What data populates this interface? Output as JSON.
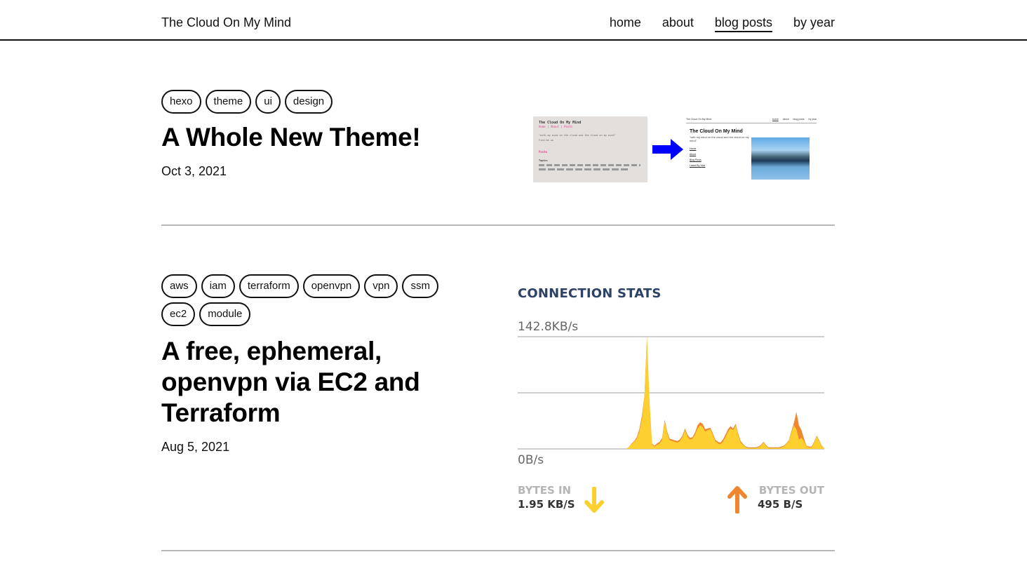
{
  "site": {
    "title": "The Cloud On My Mind"
  },
  "nav": [
    {
      "label": "home",
      "active": false
    },
    {
      "label": "about",
      "active": false
    },
    {
      "label": "blog posts",
      "active": true
    },
    {
      "label": "by year",
      "active": false
    }
  ],
  "posts": [
    {
      "tags": [
        "hexo",
        "theme",
        "ui",
        "design"
      ],
      "title": "A Whole New Theme!",
      "date": "Oct 3, 2021",
      "thumbnail": {
        "old_theme": {
          "title": "The Cloud On My Mind",
          "nav": "Home | About | Posts",
          "quote": "\"with my mind on the cloud and the cloud on my mind\"",
          "find": "Find me on",
          "posts_heading": "Posts",
          "topics_heading": "Topics"
        },
        "new_theme": {
          "bar_title": "The Cloud On My Mind",
          "bar_nav": [
            "home",
            "about",
            "blog posts",
            "by year"
          ],
          "heading": "The Cloud On My Mind",
          "quote": "\"with my mind on the cloud and the cloud on my mind\"",
          "links": [
            "Home",
            "About",
            "Blog Posts",
            "Listed By Year"
          ]
        },
        "arrow_color": "#0000ff"
      }
    },
    {
      "tags": [
        "aws",
        "iam",
        "terraform",
        "openvpn",
        "vpn",
        "ssm",
        "ec2",
        "module"
      ],
      "title": "A free, ephemeral, openvpn via EC2 and Terraform",
      "date": "Aug 5, 2021",
      "thumbnail": {
        "title": "CONNECTION STATS",
        "y_max_label": "142.8KB/s",
        "y_min_label": "0B/s",
        "bytes_in_label": "BYTES IN",
        "bytes_in_value": "1.95 KB/S",
        "bytes_out_label": "BYTES OUT",
        "bytes_out_value": "495 B/S",
        "colors": {
          "in": "#fdd02f",
          "out": "#ef8730",
          "title": "#2d4267"
        }
      }
    }
  ],
  "chart_data": {
    "type": "area",
    "title": "CONNECTION STATS",
    "ylabel": "",
    "xlabel": "",
    "ylim": [
      0,
      142.8
    ],
    "y_unit": "KB/s",
    "tick_labels": [
      "142.8KB/s",
      "0B/s"
    ],
    "grid": true,
    "series": [
      {
        "name": "bytes in",
        "color": "#fdd02f",
        "values": [
          0,
          0,
          0,
          0,
          0,
          0,
          0,
          0,
          0,
          0,
          0,
          0,
          0,
          0,
          0,
          0,
          0,
          0,
          0,
          0,
          0,
          0,
          0,
          0,
          0,
          0,
          0,
          0,
          0,
          0,
          0,
          0,
          0,
          0,
          0,
          0,
          0,
          0,
          0,
          0,
          0,
          0,
          0,
          0,
          3,
          6,
          9,
          13,
          22,
          38,
          65,
          142,
          60,
          6,
          3,
          5,
          7,
          12,
          35,
          20,
          11,
          10,
          9,
          8,
          10,
          15,
          24,
          16,
          12,
          13,
          18,
          26,
          30,
          28,
          22,
          24,
          25,
          18,
          10,
          7,
          6,
          9,
          15,
          22,
          26,
          24,
          30,
          18,
          8,
          5,
          2,
          1,
          1,
          1,
          1,
          2,
          4,
          8,
          4,
          1,
          1,
          1,
          1,
          1,
          2,
          3,
          6,
          10,
          20,
          30,
          25,
          12,
          14,
          10,
          3,
          2,
          2,
          8,
          16,
          10,
          3,
          1
        ]
      },
      {
        "name": "bytes out",
        "color": "#ef8730",
        "values": [
          0,
          0,
          0,
          0,
          0,
          0,
          0,
          0,
          0,
          0,
          0,
          0,
          0,
          0,
          0,
          0,
          0,
          0,
          0,
          0,
          0,
          0,
          0,
          0,
          0,
          0,
          0,
          0,
          0,
          0,
          0,
          0,
          0,
          0,
          0,
          0,
          0,
          0,
          0,
          0,
          0,
          0,
          0,
          0,
          0,
          1,
          1,
          2,
          3,
          4,
          2,
          1,
          1,
          1,
          1,
          2,
          2,
          2,
          2,
          2,
          2,
          2,
          2,
          2,
          2,
          2,
          2,
          2,
          2,
          2,
          3,
          4,
          4,
          4,
          3,
          2,
          2,
          2,
          2,
          2,
          2,
          3,
          3,
          3,
          3,
          2,
          2,
          2,
          2,
          1,
          1,
          1,
          1,
          1,
          1,
          1,
          1,
          1,
          1,
          1,
          1,
          1,
          1,
          1,
          1,
          1,
          1,
          1,
          2,
          3,
          22,
          18,
          10,
          3,
          1,
          1,
          1,
          1,
          1,
          1,
          1,
          0
        ]
      }
    ],
    "summary": [
      {
        "label": "BYTES IN",
        "value": "1.95 KB/S"
      },
      {
        "label": "BYTES OUT",
        "value": "495 B/S"
      }
    ]
  }
}
